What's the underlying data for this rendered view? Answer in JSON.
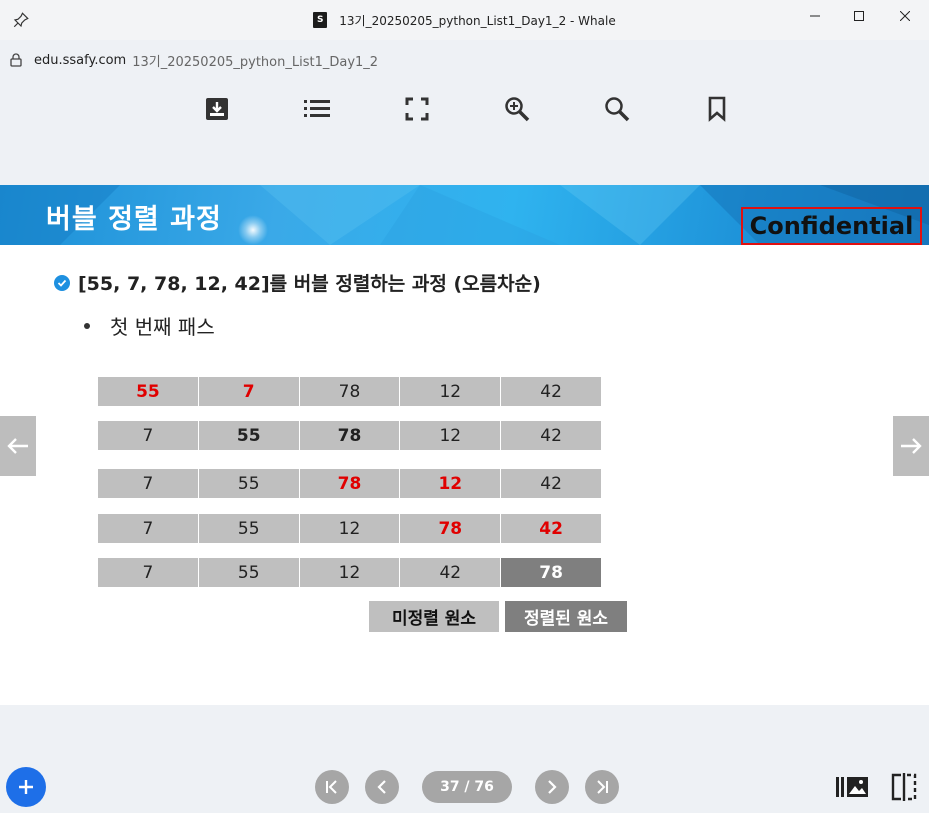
{
  "window": {
    "title": "13기_20250205_python_List1_Day1_2 - Whale",
    "favicon_text": "S"
  },
  "address": {
    "host": "edu.ssafy.com",
    "path": "13기_20250205_python_List1_Day1_2"
  },
  "toolbar": {
    "icons": [
      "download-icon",
      "list-icon",
      "fullscreen-icon",
      "zoom-in-icon",
      "search-icon",
      "bookmark-icon"
    ]
  },
  "slide": {
    "title": "버블 정렬 과정",
    "confidential": "Confidential",
    "bullet_main": "[55, 7, 78, 12, 42]를 버블 정렬하는 과정 (오름차순)",
    "bullet_sub": "첫 번째 패스",
    "rows": [
      [
        {
          "v": "55",
          "s": "red"
        },
        {
          "v": "7",
          "s": "red"
        },
        {
          "v": "78",
          "s": ""
        },
        {
          "v": "12",
          "s": ""
        },
        {
          "v": "42",
          "s": ""
        }
      ],
      [
        {
          "v": "7",
          "s": ""
        },
        {
          "v": "55",
          "s": "bold"
        },
        {
          "v": "78",
          "s": "bold"
        },
        {
          "v": "12",
          "s": ""
        },
        {
          "v": "42",
          "s": ""
        }
      ],
      [
        {
          "v": "7",
          "s": ""
        },
        {
          "v": "55",
          "s": ""
        },
        {
          "v": "78",
          "s": "red"
        },
        {
          "v": "12",
          "s": "red"
        },
        {
          "v": "42",
          "s": ""
        }
      ],
      [
        {
          "v": "7",
          "s": ""
        },
        {
          "v": "55",
          "s": ""
        },
        {
          "v": "12",
          "s": ""
        },
        {
          "v": "78",
          "s": "red"
        },
        {
          "v": "42",
          "s": "red"
        }
      ],
      [
        {
          "v": "7",
          "s": ""
        },
        {
          "v": "55",
          "s": ""
        },
        {
          "v": "12",
          "s": ""
        },
        {
          "v": "42",
          "s": ""
        },
        {
          "v": "78",
          "s": "sorted"
        }
      ]
    ],
    "legend_unsorted": "미정렬 원소",
    "legend_sorted": "정렬된 원소"
  },
  "pager": {
    "current": "37",
    "total": "76",
    "label": "37 / 76"
  },
  "colors": {
    "accent": "#1e6fe8",
    "highlight_red": "#e00000",
    "cell_gray": "#bfbfbf",
    "sorted_gray": "#7f7f7f"
  }
}
